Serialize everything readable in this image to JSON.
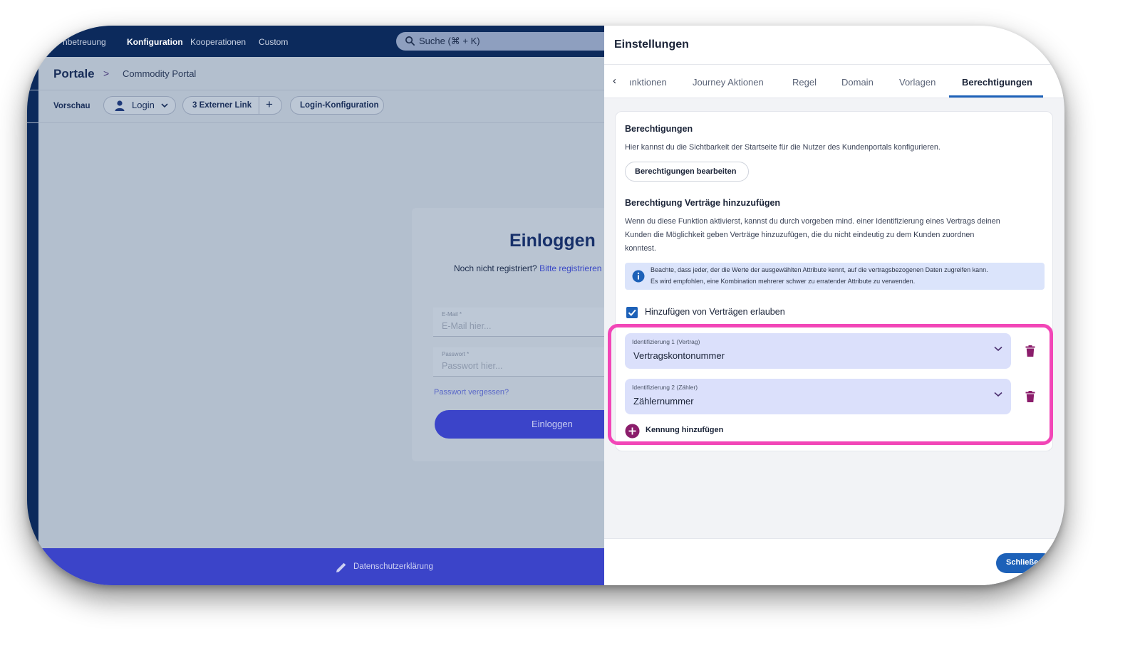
{
  "topnav": {
    "items": [
      "nbetreuung",
      "Konfiguration",
      "Kooperationen",
      "Custom"
    ],
    "active": "Konfiguration",
    "search_placeholder": "Suche (⌘ + K)"
  },
  "breadcrumb": {
    "root": "Portale",
    "current": "Commodity Portal"
  },
  "toolbar": {
    "label": "Vorschau",
    "login_dropdown": "Login",
    "external_link": "3 Externer Link",
    "add_symbol": "+",
    "login_config": "Login-Konfiguration"
  },
  "login_preview": {
    "title": "Einloggen",
    "register_prompt": "Noch nicht registriert?",
    "register_link": "Bitte registrieren",
    "email_label": "E-Mail *",
    "email_placeholder": "E-Mail hier...",
    "password_label": "Passwort *",
    "password_placeholder": "Passwort hier...",
    "forgot": "Passwort vergessen?",
    "submit": "Einloggen"
  },
  "footer": {
    "privacy": "Datenschutzerklärung"
  },
  "settings": {
    "title": "Einstellungen",
    "tabs": [
      "ınktionen",
      "Journey Aktionen",
      "Regel",
      "Domain",
      "Vorlagen",
      "Berechtigungen"
    ],
    "active_tab": "Berechtigungen",
    "permissions": {
      "heading": "Berechtigungen",
      "description": "Hier kannst du die Sichtbarkeit der Startseite für die Nutzer des Kundenportals konfigurieren.",
      "edit_button": "Berechtigungen bearbeiten"
    },
    "contracts": {
      "heading": "Berechtigung Verträge hinzuzufügen",
      "description_lines": [
        "Wenn du diese Funktion aktivierst, kannst du durch vorgeben mind. einer Identifizierung eines Vertrags deinen",
        "Kunden die Möglichkeit geben Verträge hinzuzufügen, die du nicht eindeutig zu dem Kunden zuordnen",
        "konntest."
      ],
      "info_lines": [
        "Beachte, dass jeder, der die Werte der ausgewählten Attribute kennt, auf die vertragsbezogenen Daten zugreifen kann.",
        "Es wird empfohlen, eine Kombination mehrerer schwer zu erratender Attribute zu verwenden."
      ],
      "checkbox_label": "Hinzufügen von Verträgen erlauben",
      "checkbox_checked": true,
      "identifiers": [
        {
          "label": "Identifizierung 1 (Vertrag)",
          "value": "Vertragskontonummer"
        },
        {
          "label": "Identifizierung 2 (Zähler)",
          "value": "Zählernummer"
        }
      ],
      "add_identifier": "Kennung hinzufügen"
    },
    "close_button": "Schließen"
  },
  "colors": {
    "navy": "#0c2a5c",
    "primary": "#3b44c9",
    "accent_blue": "#1d61b8",
    "highlight": "#f246b7",
    "trash": "#8b1d6b"
  }
}
